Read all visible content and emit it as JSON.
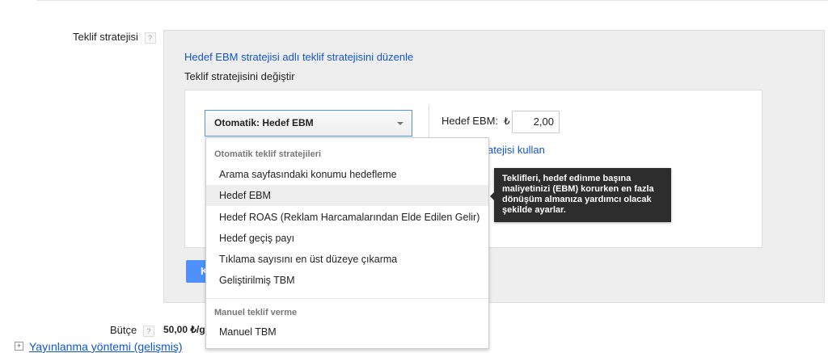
{
  "bid_strategy": {
    "label": "Teklif stratejisi",
    "help": "?",
    "edit_link": "Hedef EBM stratejisi adlı teklif stratejisini düzenle",
    "change_label": "Teklif stratejisini değiştir"
  },
  "dropdown": {
    "selected": "Otomatik: Hedef EBM",
    "groups": [
      {
        "header": "Otomatik teklif stratejileri",
        "items": [
          "Arama sayfasındaki konumu hedefleme",
          "Hedef EBM",
          "Hedef ROAS (Reklam Harcamalarından Elde Edilen Gelir)",
          "Hedef geçiş payı",
          "Tıklama sayısını en üst düzeye çıkarma",
          "Geliştirilmiş TBM"
        ]
      },
      {
        "header": "Manuel teklif verme",
        "items": [
          "Manuel TBM"
        ]
      }
    ],
    "highlighted": "Hedef EBM"
  },
  "target_cpa": {
    "label": "Hedef EBM:",
    "currency": "₺",
    "value": "2,00",
    "partial_link": "atejisi kullan"
  },
  "tooltip": "Teklifleri, hedef edinme başına maliyetinizi (EBM) korurken en fazla dönüşüm almanıza yardımcı olacak şekilde ayarlar.",
  "save_button": "K",
  "budget": {
    "label": "Bütçe",
    "help": "?",
    "value": "50,00 ₺/g"
  },
  "delivery_link": "Yayınlanma yöntemi (gelişmiş)",
  "colors": {
    "link": "#1155cc",
    "primary_button": "#4d90fe",
    "tooltip_bg": "#2d2d2d"
  }
}
